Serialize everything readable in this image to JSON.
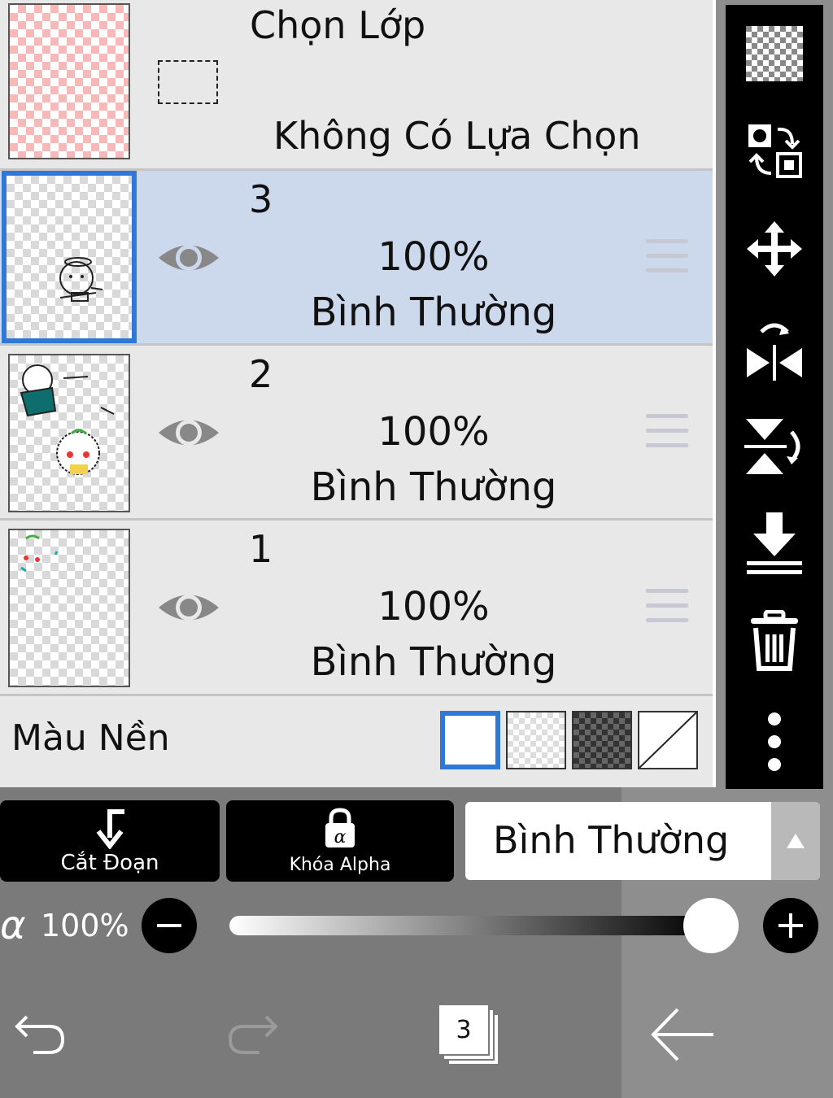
{
  "selection_layer": {
    "title": "Chọn Lớp",
    "status": "Không Có Lựa Chọn"
  },
  "layers": [
    {
      "name": "3",
      "opacity": "100%",
      "blend": "Bình Thường",
      "selected": true
    },
    {
      "name": "2",
      "opacity": "100%",
      "blend": "Bình Thường",
      "selected": false
    },
    {
      "name": "1",
      "opacity": "100%",
      "blend": "Bình Thường",
      "selected": false
    }
  ],
  "background": {
    "label": "Màu Nền",
    "options": [
      "white",
      "light-checker",
      "dark-checker",
      "none"
    ],
    "selected": "white"
  },
  "toolbar_icons": [
    "checker-icon",
    "swap-icon",
    "move-icon",
    "flip-horizontal-icon",
    "flip-vertical-icon",
    "merge-down-icon",
    "trash-icon",
    "more-icon"
  ],
  "buttons": {
    "clipping": "Cắt Đoạn",
    "alpha_lock": "Khóa Alpha"
  },
  "blend_mode": {
    "value": "Bình Thường"
  },
  "opacity": {
    "symbol": "α",
    "value": "100%",
    "level": 1.0
  },
  "nav": {
    "layer_count": "3"
  },
  "colors": {
    "accent": "#2f78d8",
    "selected_row": "#ccd9ec"
  }
}
